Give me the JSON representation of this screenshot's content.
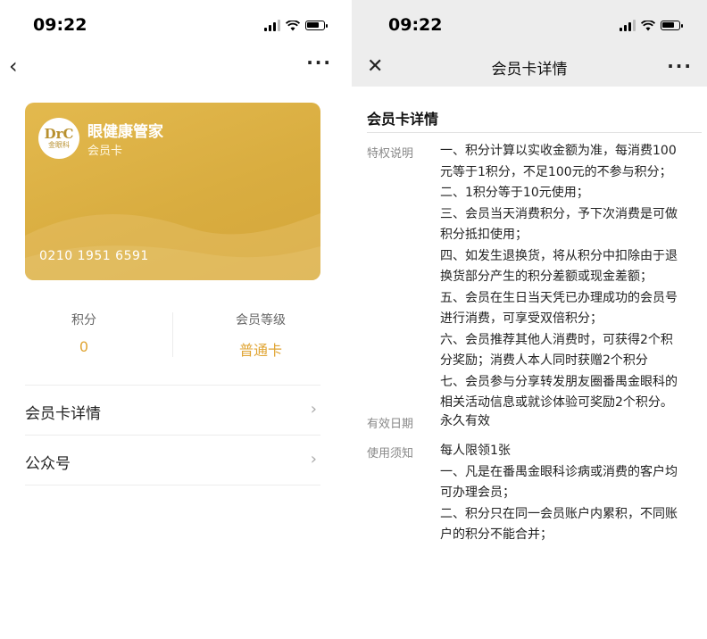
{
  "left": {
    "status": {
      "time": "09:22"
    },
    "card": {
      "logo_top": "DrC",
      "logo_bottom": "金眼科",
      "name": "眼健康管家",
      "subtitle": "会员卡",
      "number": "0210 1951 6591"
    },
    "stats": [
      {
        "label": "积分",
        "value": "0"
      },
      {
        "label": "会员等级",
        "value": "普通卡"
      }
    ],
    "list": [
      {
        "label": "会员卡详情"
      },
      {
        "label": "公众号"
      }
    ]
  },
  "right": {
    "status": {
      "time": "09:22"
    },
    "nav": {
      "title": "会员卡详情"
    },
    "section_title": "会员卡详情",
    "privilege": {
      "key": "特权说明",
      "lines": [
        "一、积分计算以实收金额为准，每消费100",
        "元等于1积分，不足100元的不参与积分；",
        "二、1积分等于10元使用；",
        "三、会员当天消费积分，予下次消费是可做",
        "积分抵扣使用；",
        "四、如发生退换货，将从积分中扣除由于退",
        "换货部分产生的积分差额或现金差额；",
        "五、会员在生日当天凭已办理成功的会员号",
        "进行消费，可享受双倍积分；",
        "六、会员推荐其他人消费时，可获得2个积",
        "分奖励；消费人本人同时获赠2个积分",
        "七、会员参与分享转发朋友圈番禺金眼科的",
        "相关活动信息或就诊体验可奖励2个积分。"
      ]
    },
    "validity": {
      "key": "有效日期",
      "value": "永久有效"
    },
    "notice": {
      "key": "使用须知",
      "lines": [
        "每人限领1张",
        "一、凡是在番禺金眼科诊病或消费的客户均",
        "可办理会员；",
        "二、积分只在同一会员账户内累积，不同账",
        "户的积分不能合并；"
      ]
    }
  },
  "colors": {
    "card_gold": "#d9ad40",
    "accent": "#e0a534",
    "header_gray": "#ededed"
  }
}
